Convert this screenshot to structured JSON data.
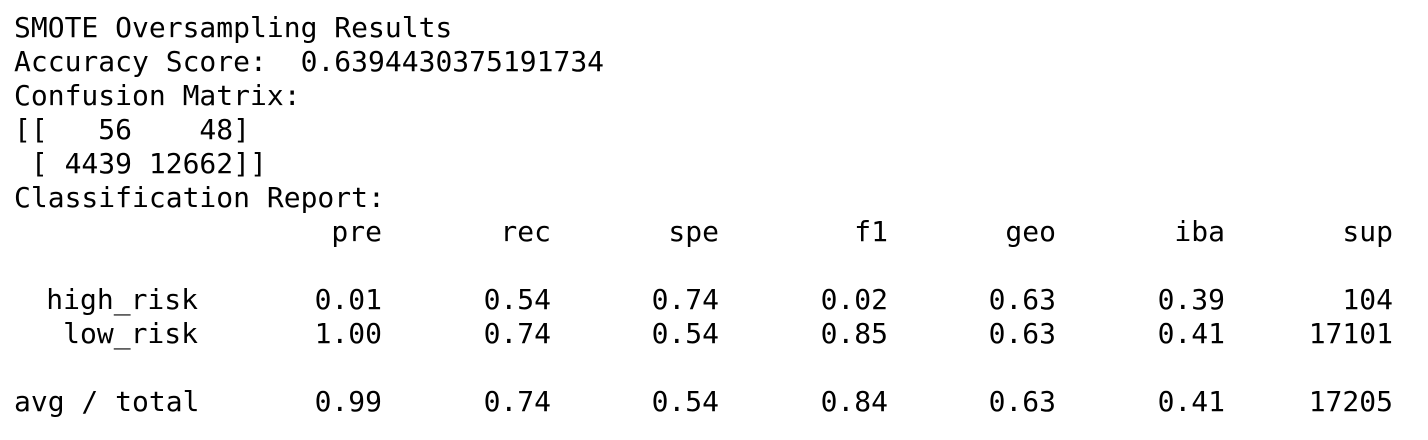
{
  "title": "SMOTE Oversampling Results",
  "accuracy": {
    "label": "Accuracy Score:",
    "value": "0.6394430375191734"
  },
  "confusion": {
    "label": "Confusion Matrix:",
    "row1": "[[   56    48]",
    "row2": " [ 4439 12662]]"
  },
  "report": {
    "label": "Classification Report:",
    "headers": [
      "pre",
      "rec",
      "spe",
      "f1",
      "geo",
      "iba",
      "sup"
    ],
    "rows": [
      {
        "label": "high_risk",
        "values": [
          "0.01",
          "0.54",
          "0.74",
          "0.02",
          "0.63",
          "0.39",
          "104"
        ]
      },
      {
        "label": "low_risk",
        "values": [
          "1.00",
          "0.74",
          "0.54",
          "0.85",
          "0.63",
          "0.41",
          "17101"
        ]
      }
    ],
    "total": {
      "label": "avg / total",
      "values": [
        "0.99",
        "0.74",
        "0.54",
        "0.84",
        "0.63",
        "0.41",
        "17205"
      ]
    }
  }
}
